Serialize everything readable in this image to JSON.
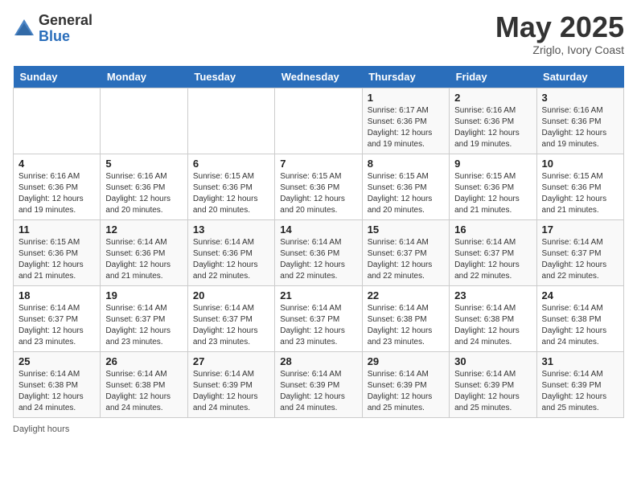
{
  "header": {
    "logo_general": "General",
    "logo_blue": "Blue",
    "month": "May 2025",
    "location": "Zriglo, Ivory Coast"
  },
  "days_of_week": [
    "Sunday",
    "Monday",
    "Tuesday",
    "Wednesday",
    "Thursday",
    "Friday",
    "Saturday"
  ],
  "weeks": [
    [
      {
        "day": "",
        "detail": ""
      },
      {
        "day": "",
        "detail": ""
      },
      {
        "day": "",
        "detail": ""
      },
      {
        "day": "",
        "detail": ""
      },
      {
        "day": "1",
        "detail": "Sunrise: 6:17 AM\nSunset: 6:36 PM\nDaylight: 12 hours\nand 19 minutes."
      },
      {
        "day": "2",
        "detail": "Sunrise: 6:16 AM\nSunset: 6:36 PM\nDaylight: 12 hours\nand 19 minutes."
      },
      {
        "day": "3",
        "detail": "Sunrise: 6:16 AM\nSunset: 6:36 PM\nDaylight: 12 hours\nand 19 minutes."
      }
    ],
    [
      {
        "day": "4",
        "detail": "Sunrise: 6:16 AM\nSunset: 6:36 PM\nDaylight: 12 hours\nand 19 minutes."
      },
      {
        "day": "5",
        "detail": "Sunrise: 6:16 AM\nSunset: 6:36 PM\nDaylight: 12 hours\nand 20 minutes."
      },
      {
        "day": "6",
        "detail": "Sunrise: 6:15 AM\nSunset: 6:36 PM\nDaylight: 12 hours\nand 20 minutes."
      },
      {
        "day": "7",
        "detail": "Sunrise: 6:15 AM\nSunset: 6:36 PM\nDaylight: 12 hours\nand 20 minutes."
      },
      {
        "day": "8",
        "detail": "Sunrise: 6:15 AM\nSunset: 6:36 PM\nDaylight: 12 hours\nand 20 minutes."
      },
      {
        "day": "9",
        "detail": "Sunrise: 6:15 AM\nSunset: 6:36 PM\nDaylight: 12 hours\nand 21 minutes."
      },
      {
        "day": "10",
        "detail": "Sunrise: 6:15 AM\nSunset: 6:36 PM\nDaylight: 12 hours\nand 21 minutes."
      }
    ],
    [
      {
        "day": "11",
        "detail": "Sunrise: 6:15 AM\nSunset: 6:36 PM\nDaylight: 12 hours\nand 21 minutes."
      },
      {
        "day": "12",
        "detail": "Sunrise: 6:14 AM\nSunset: 6:36 PM\nDaylight: 12 hours\nand 21 minutes."
      },
      {
        "day": "13",
        "detail": "Sunrise: 6:14 AM\nSunset: 6:36 PM\nDaylight: 12 hours\nand 22 minutes."
      },
      {
        "day": "14",
        "detail": "Sunrise: 6:14 AM\nSunset: 6:36 PM\nDaylight: 12 hours\nand 22 minutes."
      },
      {
        "day": "15",
        "detail": "Sunrise: 6:14 AM\nSunset: 6:37 PM\nDaylight: 12 hours\nand 22 minutes."
      },
      {
        "day": "16",
        "detail": "Sunrise: 6:14 AM\nSunset: 6:37 PM\nDaylight: 12 hours\nand 22 minutes."
      },
      {
        "day": "17",
        "detail": "Sunrise: 6:14 AM\nSunset: 6:37 PM\nDaylight: 12 hours\nand 22 minutes."
      }
    ],
    [
      {
        "day": "18",
        "detail": "Sunrise: 6:14 AM\nSunset: 6:37 PM\nDaylight: 12 hours\nand 23 minutes."
      },
      {
        "day": "19",
        "detail": "Sunrise: 6:14 AM\nSunset: 6:37 PM\nDaylight: 12 hours\nand 23 minutes."
      },
      {
        "day": "20",
        "detail": "Sunrise: 6:14 AM\nSunset: 6:37 PM\nDaylight: 12 hours\nand 23 minutes."
      },
      {
        "day": "21",
        "detail": "Sunrise: 6:14 AM\nSunset: 6:37 PM\nDaylight: 12 hours\nand 23 minutes."
      },
      {
        "day": "22",
        "detail": "Sunrise: 6:14 AM\nSunset: 6:38 PM\nDaylight: 12 hours\nand 23 minutes."
      },
      {
        "day": "23",
        "detail": "Sunrise: 6:14 AM\nSunset: 6:38 PM\nDaylight: 12 hours\nand 24 minutes."
      },
      {
        "day": "24",
        "detail": "Sunrise: 6:14 AM\nSunset: 6:38 PM\nDaylight: 12 hours\nand 24 minutes."
      }
    ],
    [
      {
        "day": "25",
        "detail": "Sunrise: 6:14 AM\nSunset: 6:38 PM\nDaylight: 12 hours\nand 24 minutes."
      },
      {
        "day": "26",
        "detail": "Sunrise: 6:14 AM\nSunset: 6:38 PM\nDaylight: 12 hours\nand 24 minutes."
      },
      {
        "day": "27",
        "detail": "Sunrise: 6:14 AM\nSunset: 6:39 PM\nDaylight: 12 hours\nand 24 minutes."
      },
      {
        "day": "28",
        "detail": "Sunrise: 6:14 AM\nSunset: 6:39 PM\nDaylight: 12 hours\nand 24 minutes."
      },
      {
        "day": "29",
        "detail": "Sunrise: 6:14 AM\nSunset: 6:39 PM\nDaylight: 12 hours\nand 25 minutes."
      },
      {
        "day": "30",
        "detail": "Sunrise: 6:14 AM\nSunset: 6:39 PM\nDaylight: 12 hours\nand 25 minutes."
      },
      {
        "day": "31",
        "detail": "Sunrise: 6:14 AM\nSunset: 6:39 PM\nDaylight: 12 hours\nand 25 minutes."
      }
    ]
  ],
  "footer": {
    "daylight_label": "Daylight hours"
  }
}
